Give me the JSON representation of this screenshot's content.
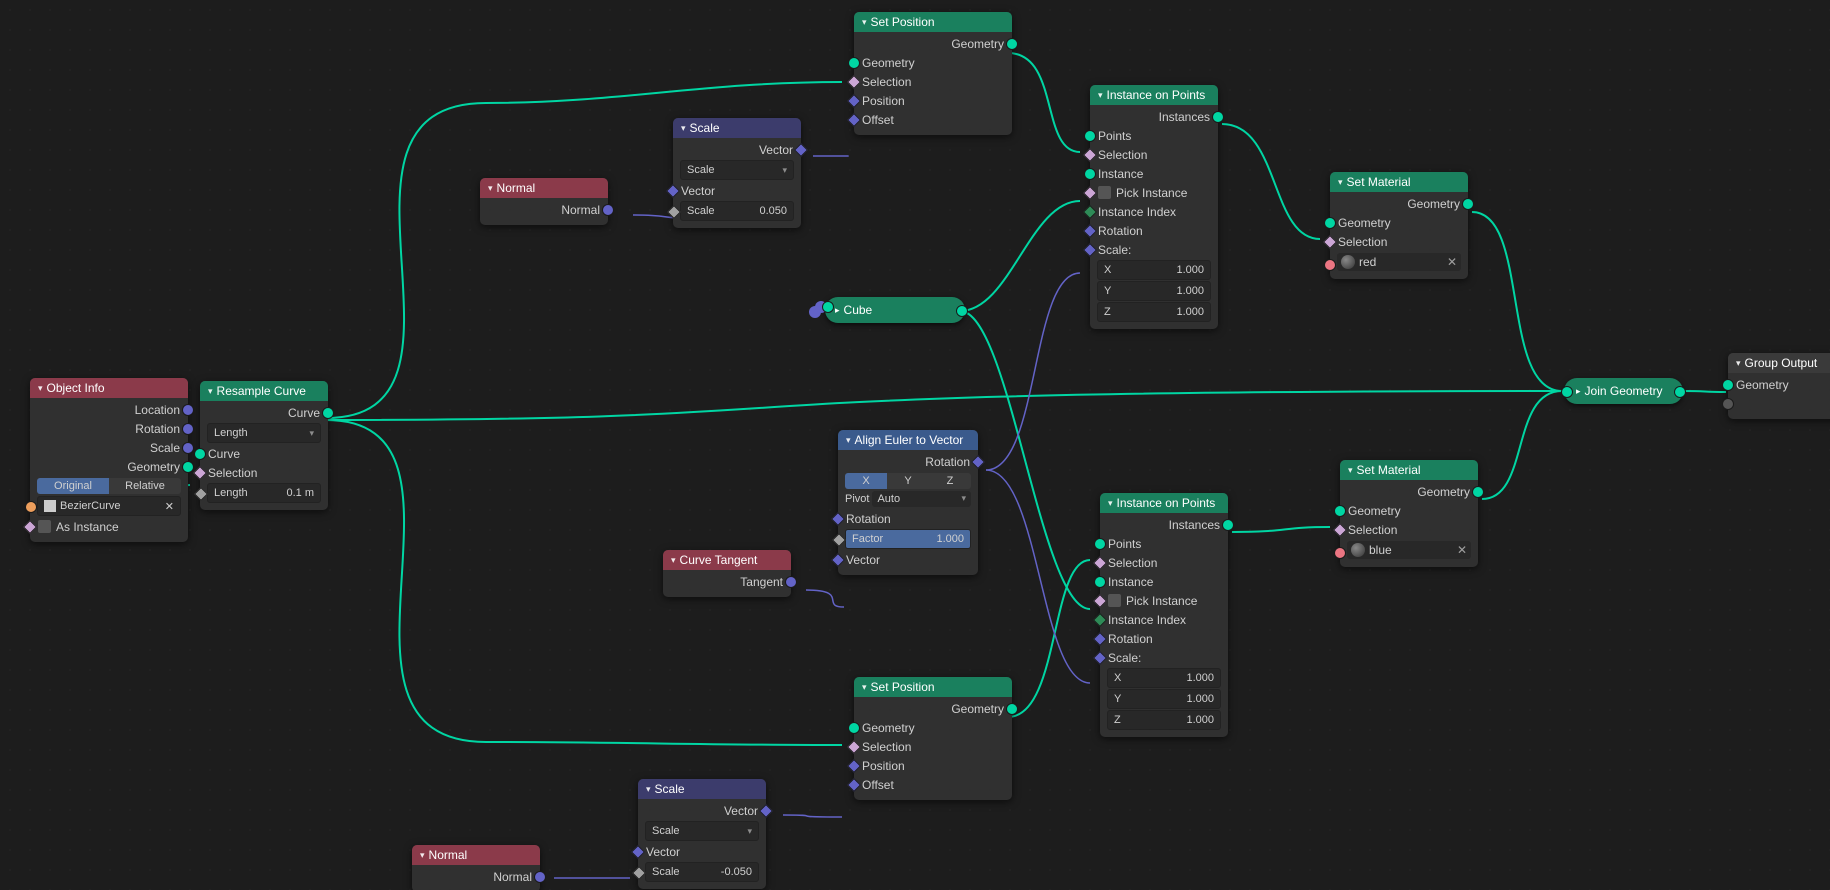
{
  "colors": {
    "geometry": "#00d6a3",
    "vector": "#6363c7"
  },
  "objectInfo": {
    "title": "Object Info",
    "outputs": [
      "Location",
      "Rotation",
      "Scale",
      "Geometry"
    ],
    "mode": [
      "Original",
      "Relative"
    ],
    "objName": "BezierCurve",
    "asInst": "As Instance"
  },
  "resample": {
    "title": "Resample Curve",
    "outCurve": "Curve",
    "inCurve": "Curve",
    "inSel": "Selection",
    "mode": "Length",
    "lenLabel": "Length",
    "lenVal": "0.1 m"
  },
  "normal1": {
    "title": "Normal",
    "out": "Normal"
  },
  "normal2": {
    "title": "Normal",
    "out": "Normal"
  },
  "scale1": {
    "title": "Scale",
    "outVec": "Vector",
    "mode": "Scale",
    "inVec": "Vector",
    "scLabel": "Scale",
    "scVal": "0.050"
  },
  "scale2": {
    "title": "Scale",
    "outVec": "Vector",
    "mode": "Scale",
    "inVec": "Vector",
    "scLabel": "Scale",
    "scVal": "-0.050"
  },
  "curveTangent": {
    "title": "Curve Tangent",
    "out": "Tangent"
  },
  "setPos1": {
    "title": "Set Position",
    "outGeo": "Geometry",
    "inGeo": "Geometry",
    "inSel": "Selection",
    "inPos": "Position",
    "inOff": "Offset"
  },
  "setPos2": {
    "title": "Set Position",
    "outGeo": "Geometry",
    "inGeo": "Geometry",
    "inSel": "Selection",
    "inPos": "Position",
    "inOff": "Offset"
  },
  "alignEuler": {
    "title": "Align Euler to Vector",
    "outRot": "Rotation",
    "axis": [
      "X",
      "Y",
      "Z"
    ],
    "pivotLabel": "Pivot",
    "pivot": "Auto",
    "inRot": "Rotation",
    "facLabel": "Factor",
    "facVal": "1.000",
    "inVec": "Vector"
  },
  "cube": {
    "title": "Cube"
  },
  "iop1": {
    "title": "Instance on Points",
    "out": "Instances",
    "pts": "Points",
    "sel": "Selection",
    "inst": "Instance",
    "pick": "Pick Instance",
    "idx": "Instance Index",
    "rot": "Rotation",
    "scl": "Scale:",
    "x": "X",
    "y": "Y",
    "z": "Z",
    "v": "1.000"
  },
  "iop2": {
    "title": "Instance on Points",
    "out": "Instances",
    "pts": "Points",
    "sel": "Selection",
    "inst": "Instance",
    "pick": "Pick Instance",
    "idx": "Instance Index",
    "rot": "Rotation",
    "scl": "Scale:",
    "x": "X",
    "y": "Y",
    "z": "Z",
    "v": "1.000"
  },
  "setMat1": {
    "title": "Set Material",
    "out": "Geometry",
    "geo": "Geometry",
    "sel": "Selection",
    "mat": "red"
  },
  "setMat2": {
    "title": "Set Material",
    "out": "Geometry",
    "geo": "Geometry",
    "sel": "Selection",
    "mat": "blue"
  },
  "join": {
    "title": "Join Geometry"
  },
  "groupOut": {
    "title": "Group Output",
    "geo": "Geometry"
  }
}
